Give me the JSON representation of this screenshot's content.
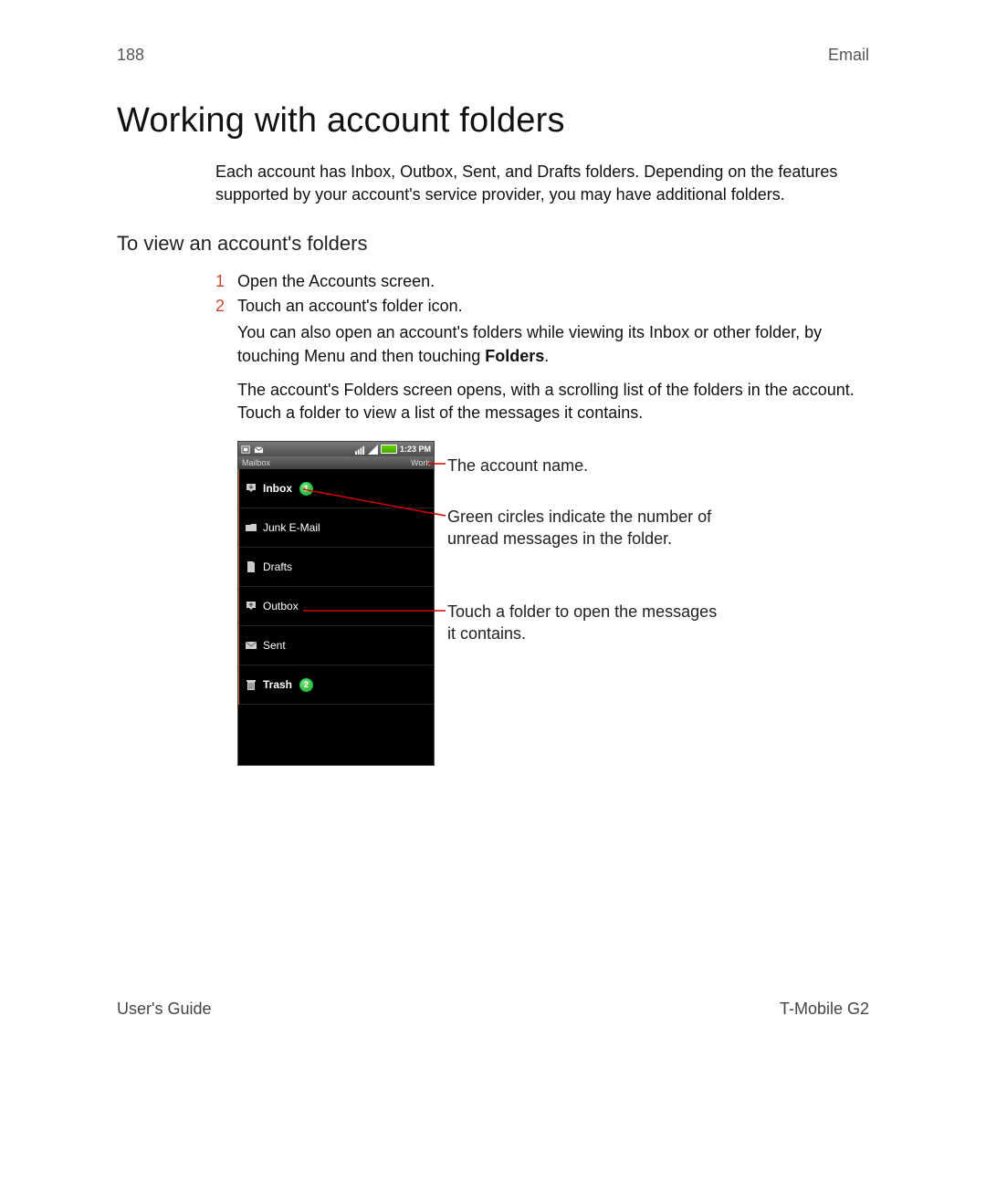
{
  "header": {
    "page_number": "188",
    "section": "Email"
  },
  "title": "Working with account folders",
  "intro": "Each account has Inbox, Outbox, Sent, and Drafts folders. Depending on the features supported by your account's service provider, you may have additional folders.",
  "subheading": "To view an account's folders",
  "steps": {
    "s1_num": "1",
    "s1_text": "Open the Accounts screen.",
    "s2_num": "2",
    "s2_text": "Touch an account's folder icon."
  },
  "para_after_step2_a": "You can also open an account's folders while viewing its Inbox or other folder, by touching ",
  "menu_word": "Menu",
  "para_after_step2_b": " and then touching ",
  "folders_word": "Folders",
  "period": ".",
  "para_after_step2_c": "The account's Folders screen opens, with a scrolling list of the folders in the account. Touch a folder to view a list of the messages it contains.",
  "phone": {
    "status_time": "1:23 PM",
    "mailbox_label": "Mailbox",
    "account_name": "Work",
    "folders": [
      {
        "label": "Inbox",
        "bold": true,
        "badge": "1",
        "icon": "inbox"
      },
      {
        "label": "Junk E-Mail",
        "bold": false,
        "badge": "",
        "icon": "folder"
      },
      {
        "label": "Drafts",
        "bold": false,
        "badge": "",
        "icon": "draft"
      },
      {
        "label": "Outbox",
        "bold": false,
        "badge": "",
        "icon": "outbox"
      },
      {
        "label": "Sent",
        "bold": false,
        "badge": "",
        "icon": "sent"
      },
      {
        "label": "Trash",
        "bold": true,
        "badge": "2",
        "icon": "trash"
      }
    ]
  },
  "callouts": {
    "c1": "The account name.",
    "c2": "Green circles indicate the number of unread messages in the folder.",
    "c3": "Touch a folder to open the messages it contains."
  },
  "footer": {
    "left": "User's Guide",
    "right": "T-Mobile G2"
  }
}
